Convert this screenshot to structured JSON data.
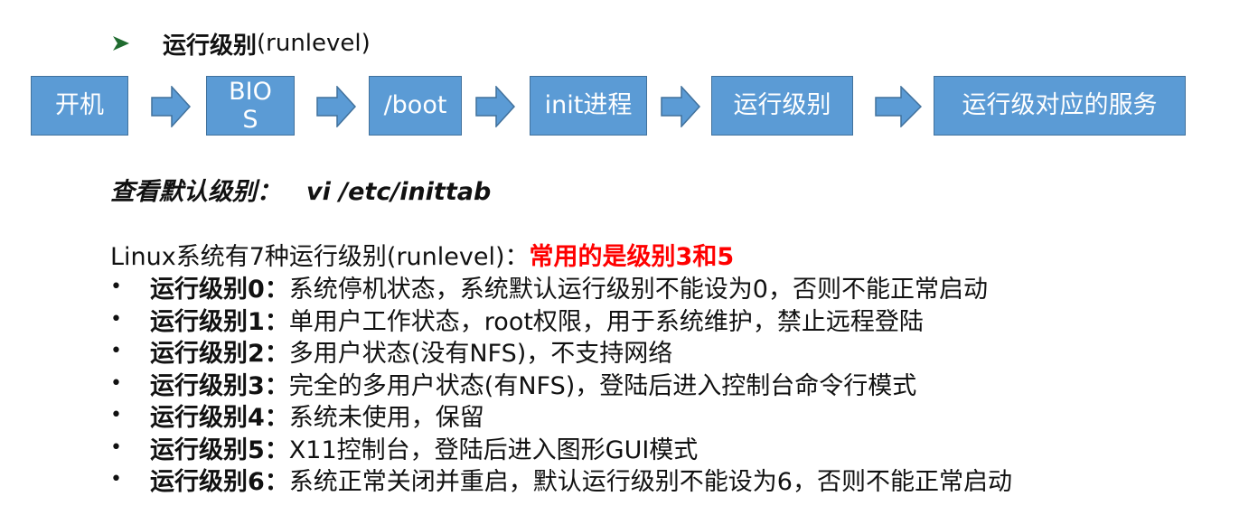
{
  "heading": {
    "bold": "运行级别",
    "rest": "(runlevel)"
  },
  "flow": [
    "开机",
    "BIO\nS",
    "/boot",
    "init进程",
    "运行级别",
    "运行级对应的服务"
  ],
  "view": {
    "label": "查看默认级别：",
    "command": "vi /etc/inittab"
  },
  "intro": {
    "text": "Linux系统有7种运行级别(runlevel)：",
    "highlight": "常用的是级别3和5"
  },
  "levels": [
    {
      "name": "运行级别0：",
      "desc": "系统停机状态，系统默认运行级别不能设为0，否则不能正常启动"
    },
    {
      "name": "运行级别1：",
      "desc": "单用户工作状态，root权限，用于系统维护，禁止远程登陆"
    },
    {
      "name": "运行级别2：",
      "desc": "多用户状态(没有NFS)，不支持网络"
    },
    {
      "name": "运行级别3：",
      "desc": "完全的多用户状态(有NFS)，登陆后进入控制台命令行模式"
    },
    {
      "name": "运行级别4：",
      "desc": "系统未使用，保留"
    },
    {
      "name": "运行级别5：",
      "desc": "X11控制台，登陆后进入图形GUI模式"
    },
    {
      "name": "运行级别6：",
      "desc": "系统正常关闭并重启，默认运行级别不能设为6，否则不能正常启动"
    }
  ],
  "colors": {
    "box_fill": "#5b9bd5",
    "box_border": "#41719c",
    "highlight": "#ff0000",
    "heading_arrow": "#2e7d32"
  },
  "icons": {
    "heading_marker": "arrow-icon",
    "flow_connector": "right-arrow-icon"
  }
}
